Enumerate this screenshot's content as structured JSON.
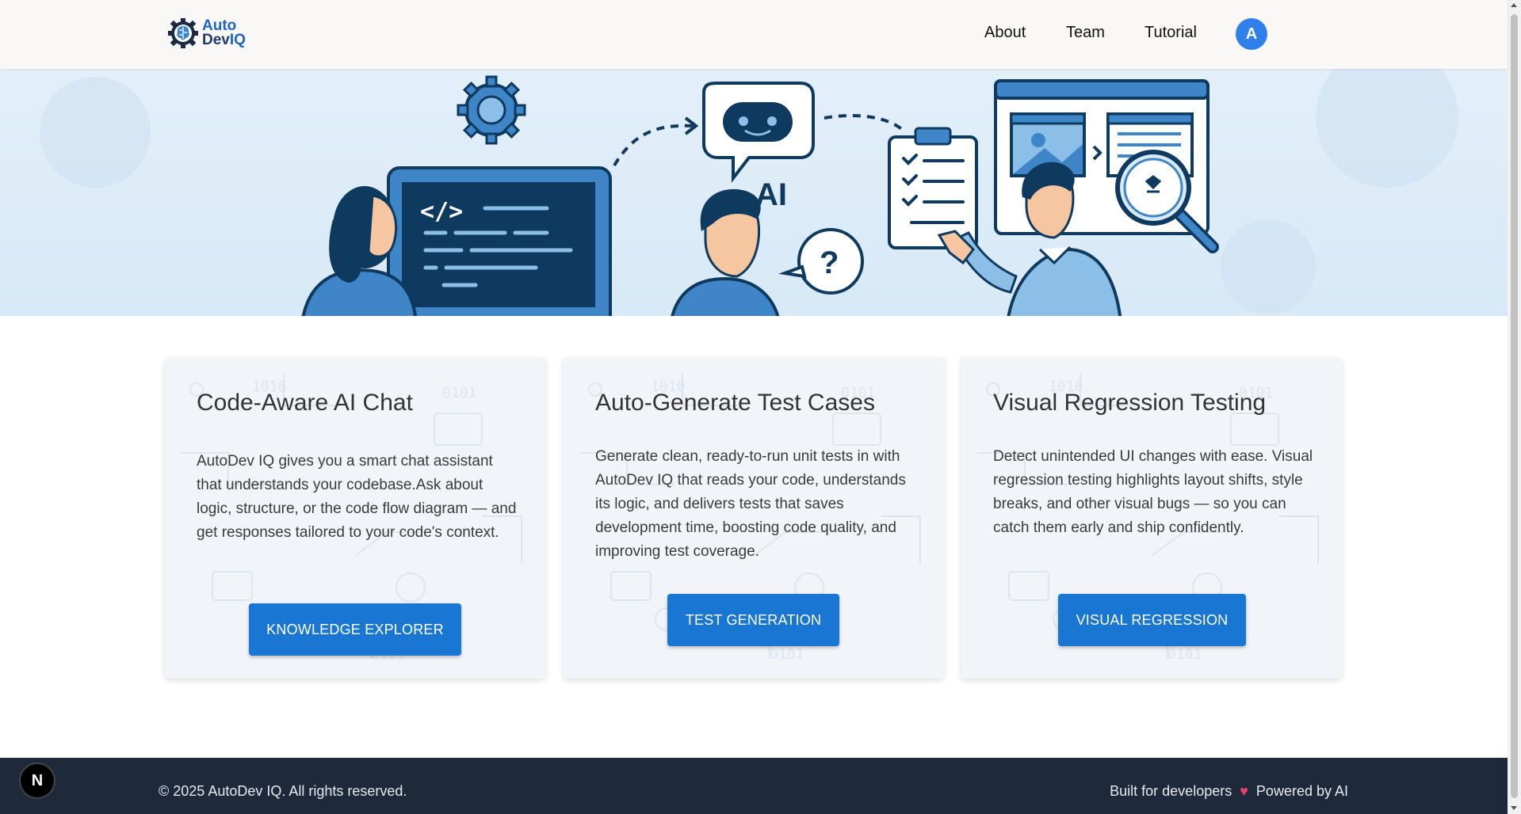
{
  "header": {
    "logo": {
      "line1": "Auto",
      "line2_prefix": "Dev",
      "line2_suffix": "IQ"
    },
    "nav": [
      {
        "label": "About"
      },
      {
        "label": "Team"
      },
      {
        "label": "Tutorial"
      }
    ],
    "avatar_initial": "A"
  },
  "hero": {
    "ai_label": "AI",
    "question_mark": "?",
    "code_tag": "</>"
  },
  "cards": [
    {
      "title": "Code-Aware AI Chat",
      "description": "AutoDev IQ gives you a smart chat assistant that understands your codebase.Ask about logic, structure, or the code flow diagram — and get responses tailored to your code's context.",
      "button": "KNOWLEDGE EXPLORER"
    },
    {
      "title": "Auto-Generate Test Cases",
      "description": "Generate clean, ready-to-run unit tests in with AutoDev IQ that reads your code, understands its logic, and delivers tests that saves development time, boosting code quality, and improving test coverage.",
      "button": "TEST GENERATION"
    },
    {
      "title": "Visual Regression Testing",
      "description": "Detect unintended UI changes with ease. Visual regression testing highlights layout shifts, style breaks, and other visual bugs — so you can catch them early and ship confidently.",
      "button": "VISUAL REGRESSION"
    }
  ],
  "footer": {
    "copyright": "© 2025 AutoDev IQ. All rights reserved.",
    "built_for": "Built for developers",
    "heart": "♥",
    "powered_by": "Powered by AI"
  },
  "next_badge": "N",
  "colors": {
    "primary": "#1976d2",
    "avatar": "#2f80ed",
    "footer_bg": "#1e293b",
    "hero_bg": "#dcebf8",
    "illustration_dark": "#0f3a5f",
    "illustration_mid": "#3f86c9"
  }
}
